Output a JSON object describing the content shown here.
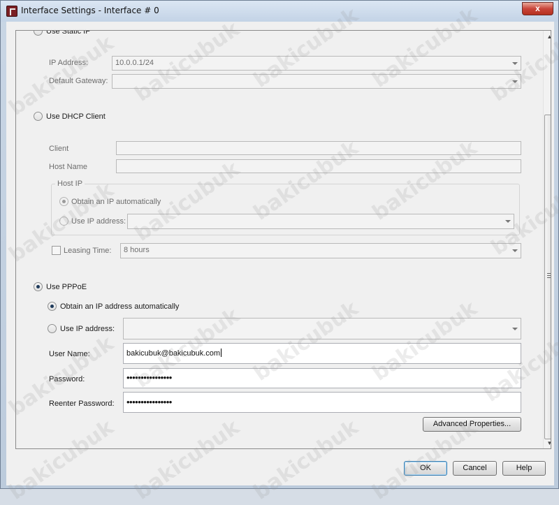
{
  "window": {
    "title": "Interface Settings - Interface # 0",
    "close_glyph": "x"
  },
  "static_ip": {
    "radio_label": "Use Static IP",
    "selected": false,
    "ip_address_label": "IP Address:",
    "ip_address_value": "10.0.0.1/24",
    "default_gateway_label": "Default Gateway:",
    "default_gateway_value": ""
  },
  "dhcp": {
    "radio_label": "Use DHCP Client",
    "selected": false,
    "client_label": "Client",
    "client_value": "",
    "host_name_label": "Host Name",
    "host_name_value": "",
    "host_ip_group": "Host IP",
    "obtain_auto_label": "Obtain an IP automatically",
    "obtain_auto_selected": true,
    "use_ip_label": "Use IP address:",
    "use_ip_value": "",
    "leasing_time_label": "Leasing Time:",
    "leasing_time_checked": false,
    "leasing_time_value": "8 hours"
  },
  "pppoe": {
    "radio_label": "Use PPPoE",
    "selected": true,
    "obtain_auto_label": "Obtain an IP address automatically",
    "obtain_auto_selected": true,
    "use_ip_label": "Use IP address:",
    "use_ip_value": "",
    "user_name_label": "User Name:",
    "user_name_value": "bakicubuk@bakicubuk.com",
    "password_label": "Password:",
    "password_value": "••••••••••••••••",
    "reenter_password_label": "Reenter Password:",
    "reenter_password_value": "••••••••••••••••",
    "advanced_button": "Advanced Properties..."
  },
  "footer": {
    "ok": "OK",
    "cancel": "Cancel",
    "help": "Help"
  },
  "watermark_text": "bakicubuk",
  "colors": {
    "title_bar": "#c3d3e6",
    "close_button": "#c9453a",
    "dialog_bg": "#f0f0f0"
  }
}
